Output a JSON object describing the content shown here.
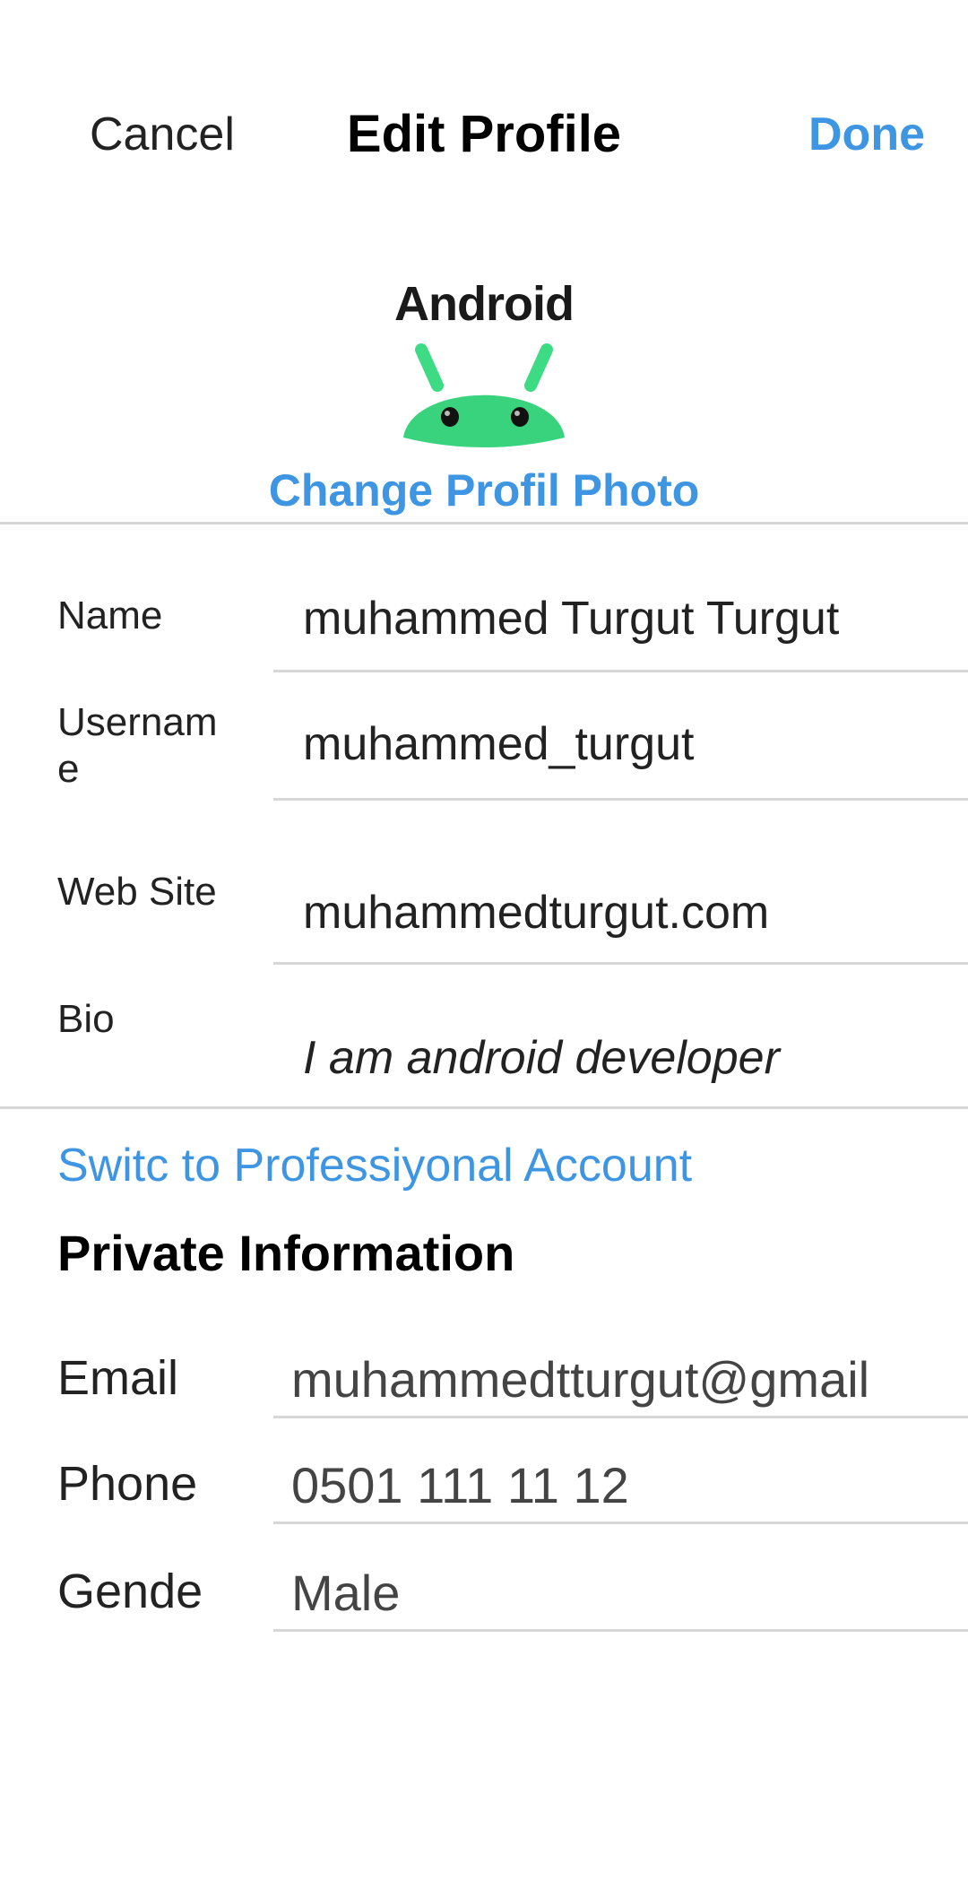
{
  "header": {
    "cancel_label": "Cancel",
    "title": "Edit Profile",
    "done_label": "Done"
  },
  "avatar": {
    "logo_text": "Android",
    "change_photo_label": "Change Profil Photo"
  },
  "profile_fields": {
    "name": {
      "label": "Name",
      "value": "muhammed Turgut Turgut"
    },
    "username": {
      "label_line1": "Usernam",
      "label_line2": "e",
      "value": "muhammed_turgut"
    },
    "website": {
      "label": "Web Site",
      "value": "muhammedturgut.com"
    },
    "bio": {
      "label": "Bio",
      "value": "I am android developer"
    }
  },
  "professional_link": "Switc to Professiyonal Account",
  "private_info": {
    "title": "Private Information",
    "email": {
      "label": "Email",
      "value": "muhammedtturgut@gmail"
    },
    "phone": {
      "label": "Phone",
      "value": "0501 111 11 12"
    },
    "gender": {
      "label": "Gende",
      "value": "Male"
    }
  },
  "colors": {
    "accent": "#3e95e2",
    "android_green": "#3ddc84",
    "divider": "#d6d6d6"
  }
}
